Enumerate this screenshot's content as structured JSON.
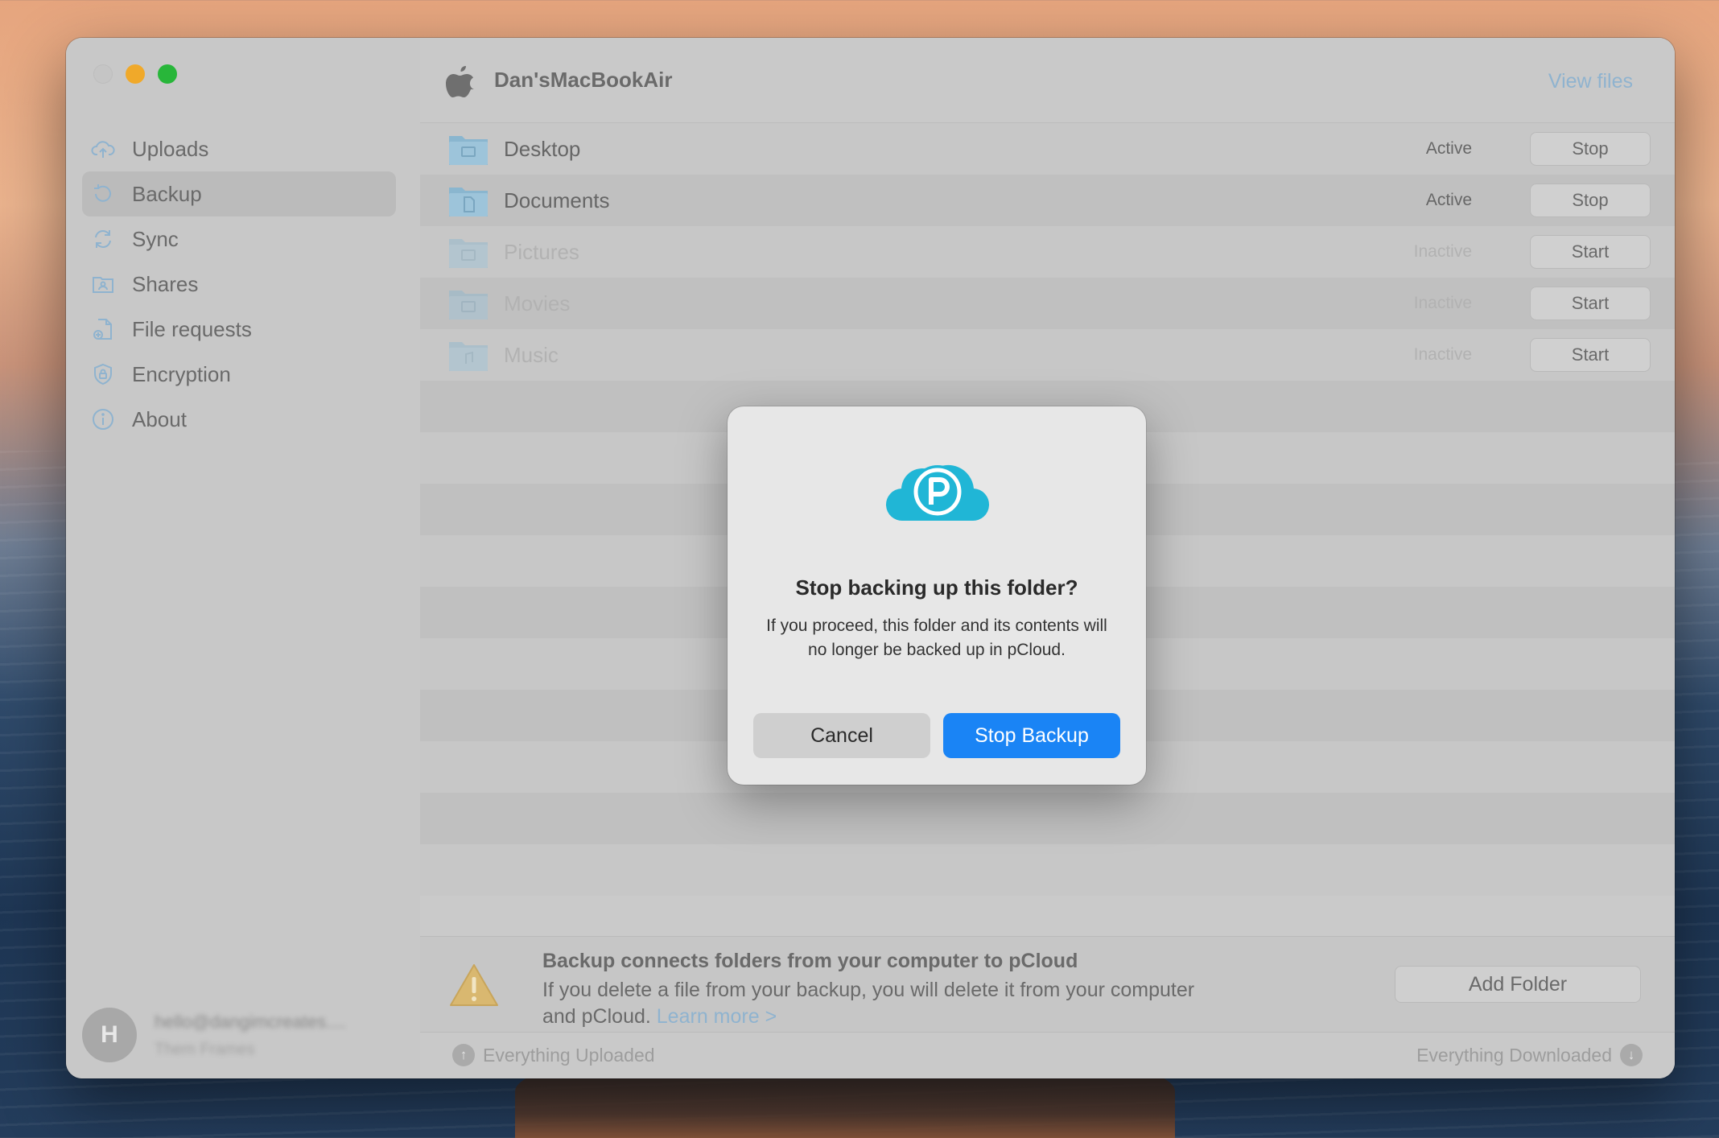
{
  "window": {
    "device_name": "Dan'sMacBookAir",
    "view_files_label": "View files"
  },
  "sidebar": {
    "items": [
      {
        "label": "Uploads",
        "icon": "cloud-upload-icon",
        "selected": false
      },
      {
        "label": "Backup",
        "icon": "backup-history-icon",
        "selected": true
      },
      {
        "label": "Sync",
        "icon": "sync-icon",
        "selected": false
      },
      {
        "label": "Shares",
        "icon": "shared-folder-icon",
        "selected": false
      },
      {
        "label": "File requests",
        "icon": "file-request-icon",
        "selected": false
      },
      {
        "label": "Encryption",
        "icon": "shield-lock-icon",
        "selected": false
      },
      {
        "label": "About",
        "icon": "info-icon",
        "selected": false
      }
    ],
    "user": {
      "initial": "H",
      "email": "hello@dangimcreates....",
      "plan": "Them Frames"
    }
  },
  "backup": {
    "folders": [
      {
        "name": "Desktop",
        "status": "Active",
        "action": "Stop"
      },
      {
        "name": "Documents",
        "status": "Active",
        "action": "Stop"
      },
      {
        "name": "Pictures",
        "status": "Inactive",
        "action": "Start"
      },
      {
        "name": "Movies",
        "status": "Inactive",
        "action": "Start"
      },
      {
        "name": "Music",
        "status": "Inactive",
        "action": "Start"
      }
    ]
  },
  "info": {
    "title": "Backup connects folders from your computer to pCloud",
    "body": "If you delete a file from your backup, you will delete it from your computer and pCloud.",
    "learn_more": "Learn more >",
    "add_folder_label": "Add Folder"
  },
  "statusbar": {
    "uploaded": "Everything Uploaded",
    "downloaded": "Everything Downloaded"
  },
  "dialog": {
    "title": "Stop backing up this folder?",
    "body": "If you proceed, this folder and its contents will no longer be backed up in pCloud.",
    "cancel_label": "Cancel",
    "confirm_label": "Stop Backup"
  },
  "colors": {
    "accent": "#1a84f5",
    "pcloud_brand": "#20b6d6",
    "traffic_min": "#f0a92a",
    "traffic_max": "#28b63a"
  }
}
